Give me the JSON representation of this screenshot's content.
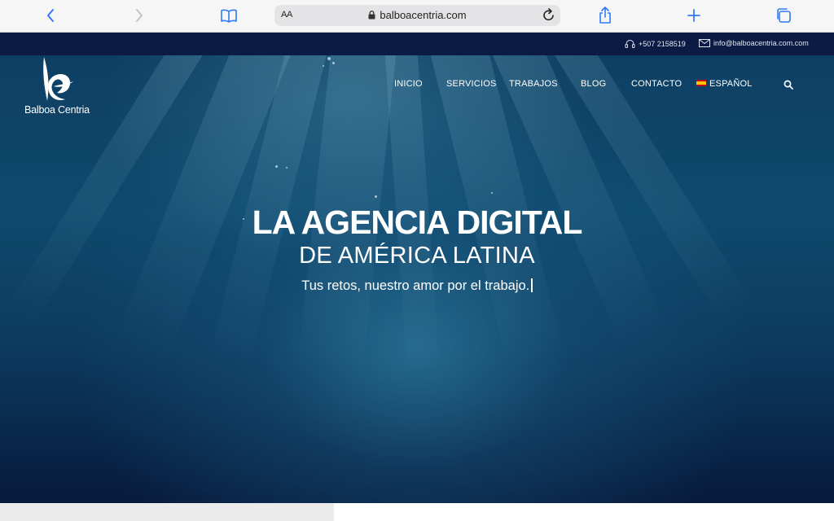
{
  "browser": {
    "text_size_label": "AA",
    "url": "balboacentria.com"
  },
  "topbar": {
    "phone": "+507 2158519",
    "email": "info@balboacentria.com.com"
  },
  "logo": {
    "text": "Balboa Centria"
  },
  "nav": {
    "items": [
      {
        "label": "INICIO"
      },
      {
        "label": "SERVICIOS"
      },
      {
        "label": "TRABAJOS"
      },
      {
        "label": "BLOG"
      },
      {
        "label": "CONTACTO"
      },
      {
        "label": "ESPAÑOL"
      }
    ]
  },
  "hero": {
    "headline": "LA AGENCIA DIGITAL",
    "subheadline": "DE AMÉRICA LATINA",
    "tagline": "Tus retos, nuestro amor por el trabajo."
  },
  "icons": [
    "back-icon",
    "forward-icon",
    "bookmarks-icon",
    "lock-icon",
    "reload-icon",
    "share-icon",
    "new-tab-icon",
    "tabs-icon",
    "headset-icon",
    "mail-icon",
    "search-icon",
    "spain-flag-icon"
  ],
  "colors": {
    "topbar": "#0b1b44",
    "hero_dark": "#071a3b",
    "browser_accent": "#2f7bf6"
  }
}
